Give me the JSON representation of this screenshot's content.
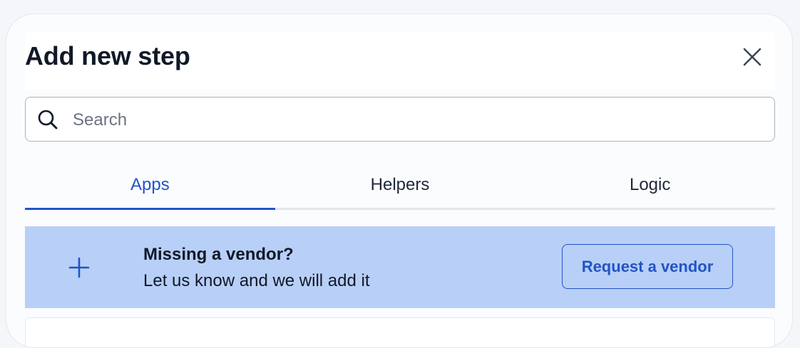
{
  "dialog": {
    "title": "Add new step",
    "close_icon": "close-icon"
  },
  "search": {
    "placeholder": "Search",
    "value": "",
    "icon": "search-icon"
  },
  "tabs": [
    {
      "label": "Apps",
      "active": true
    },
    {
      "label": "Helpers",
      "active": false
    },
    {
      "label": "Logic",
      "active": false
    }
  ],
  "banner": {
    "icon": "plus-icon",
    "heading": "Missing a vendor?",
    "subtext": "Let us know and we will add it",
    "button_label": "Request a vendor"
  },
  "colors": {
    "accent": "#2254c5",
    "banner_bg": "#b8cff7",
    "page_bg": "#f4f6f9"
  }
}
